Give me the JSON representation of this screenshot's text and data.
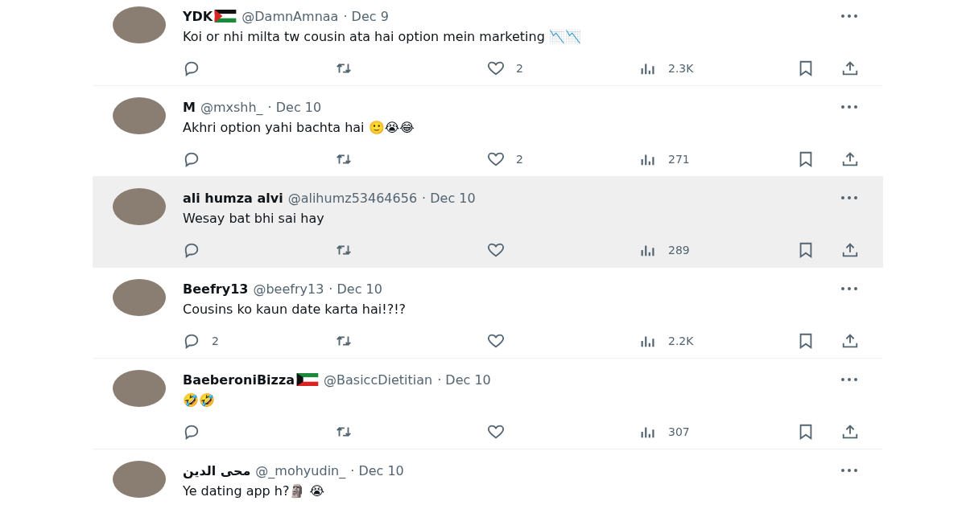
{
  "replies": [
    {
      "name": "YDK",
      "flag": {
        "kind": "palestine"
      },
      "handle": "@DamnAmnaa",
      "date": "· Dec 9",
      "text": "Koi or nhi milta tw cousin ata hai option mein marketing 📉📉",
      "highlighted": false,
      "likes": "2",
      "views": "2.3K"
    },
    {
      "name": "M",
      "handle": "@mxshh_",
      "date": "· Dec 10",
      "text": "Akhri option yahi bachta hai 🙂😭😂",
      "highlighted": false,
      "likes": "2",
      "views": "271"
    },
    {
      "name": "ali humza alvi",
      "handle": "@alihumz53464656",
      "date": "· Dec 10",
      "text": "Wesay bat bhi sai hay",
      "highlighted": true,
      "views": "289"
    },
    {
      "name": "Beefry13",
      "handle": "@beefry13",
      "date": "· Dec 10",
      "text": "Cousins ko kaun date karta hai!?!?",
      "highlighted": false,
      "replies_count": "2",
      "views": "2.2K"
    },
    {
      "name": "BaeberoniBizza",
      "flag": {
        "kind": "kuwait"
      },
      "handle": "@BasiccDietitian",
      "date": "· Dec 10",
      "text": "🤣🤣",
      "highlighted": false,
      "views": "307"
    },
    {
      "name": "محی الدین",
      "handle": "@_mohyudin_",
      "date": "· Dec 10",
      "text": "Ye dating app h?🗿 😭",
      "highlighted": false
    }
  ]
}
